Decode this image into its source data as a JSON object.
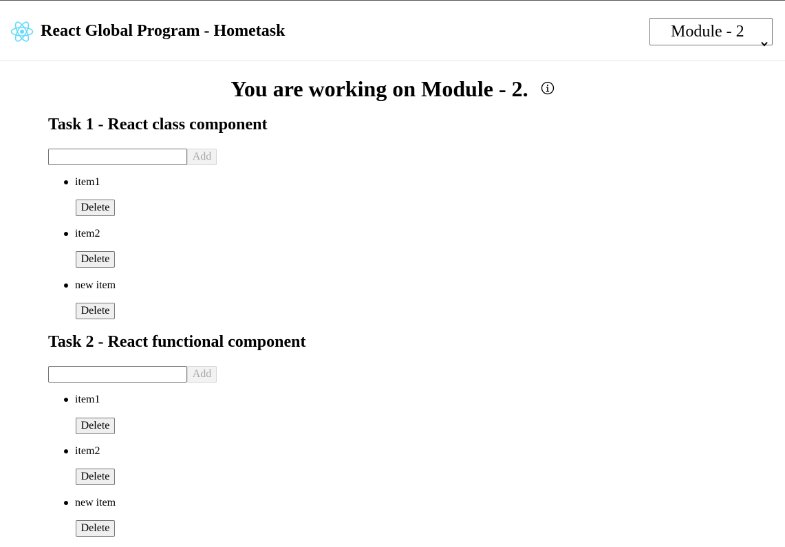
{
  "header": {
    "logo_icon": "react-atom-icon",
    "title": "React Global Program - Hometask",
    "module_select": {
      "selected": "Module - 2"
    }
  },
  "main": {
    "working_title": "You are working on Module - 2.",
    "info_icon": "info-circle-icon",
    "tasks": [
      {
        "heading": "Task 1 - React class component",
        "input_value": "",
        "add_label": "Add",
        "items": [
          {
            "text": "item1",
            "delete_label": "Delete"
          },
          {
            "text": "item2",
            "delete_label": "Delete"
          },
          {
            "text": "new item",
            "delete_label": "Delete"
          }
        ]
      },
      {
        "heading": "Task 2 - React functional component",
        "input_value": "",
        "add_label": "Add",
        "items": [
          {
            "text": "item1",
            "delete_label": "Delete"
          },
          {
            "text": "item2",
            "delete_label": "Delete"
          },
          {
            "text": "new item",
            "delete_label": "Delete"
          }
        ]
      }
    ]
  },
  "colors": {
    "react_logo": "#61dafb"
  }
}
